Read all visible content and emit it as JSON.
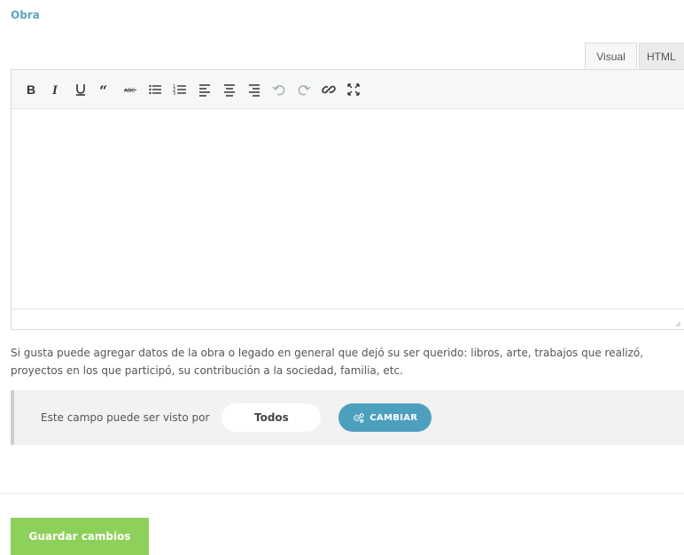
{
  "field": {
    "label": "Obra"
  },
  "editor": {
    "tabs": [
      {
        "label": "Visual",
        "active": true
      },
      {
        "label": "HTML",
        "active": false
      }
    ],
    "toolbar": [
      {
        "name": "bold-icon",
        "disabled": false
      },
      {
        "name": "italic-icon",
        "disabled": false
      },
      {
        "name": "underline-icon",
        "disabled": false
      },
      {
        "name": "blockquote-icon",
        "disabled": false
      },
      {
        "name": "strikethrough-icon",
        "disabled": false
      },
      {
        "name": "bullet-list-icon",
        "disabled": false
      },
      {
        "name": "numbered-list-icon",
        "disabled": false
      },
      {
        "name": "align-left-icon",
        "disabled": false
      },
      {
        "name": "align-center-icon",
        "disabled": false
      },
      {
        "name": "align-right-icon",
        "disabled": false
      },
      {
        "name": "undo-icon",
        "disabled": true
      },
      {
        "name": "redo-icon",
        "disabled": true
      },
      {
        "name": "link-icon",
        "disabled": false
      },
      {
        "name": "fullscreen-icon",
        "disabled": false
      }
    ],
    "content": ""
  },
  "help_text": "Si gusta puede agregar datos de la obra o legado en general que dejó su ser querido: libros, arte, trabajos que realizó, proyectos en los que participó, su contribución a la sociedad, familia, etc.",
  "visibility": {
    "label": "Este campo puede ser visto por",
    "value": "Todos",
    "change_label": "CAMBIAR",
    "change_icon": "gears-icon"
  },
  "actions": {
    "save_label": "Guardar cambios"
  },
  "colors": {
    "accent": "#4d9fbe",
    "save": "#8dd05a",
    "label": "#5aa3c4"
  }
}
